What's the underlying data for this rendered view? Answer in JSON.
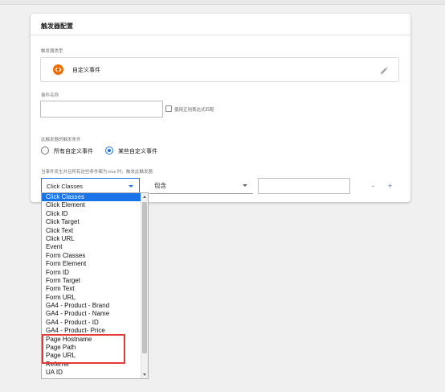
{
  "card": {
    "title": "触发器配置",
    "trigger_type_label": "触发器类型",
    "trigger_type_name": "自定义事件",
    "event_name_label": "事件名称",
    "event_name_value": "",
    "regex_checkbox_label": "使用正则表达式匹配",
    "fires_on_label": "此触发器的触发条件",
    "radio_all": "所有自定义事件",
    "radio_some": "某些自定义事件",
    "condition_label": "当事件发生并且所有这些条件都为 true 时，触发此触发器",
    "variable_select": "Click Classes",
    "operator_select": "包含",
    "condition_value": "",
    "remove_button": "-",
    "add_button": "+"
  },
  "dropdown": {
    "selected": "Click Classes",
    "items": [
      "Click Classes",
      "Click Element",
      "Click ID",
      "Click Target",
      "Click Text",
      "Click URL",
      "Event",
      "Form Classes",
      "Form Element",
      "Form ID",
      "Form Target",
      "Form Text",
      "Form URL",
      "GA4 - Product - Brand",
      "GA4 - Product - Name",
      "GA4 - Product - ID",
      "GA4 - Product- Price",
      "Page Hostname",
      "Page Path",
      "Page URL",
      "Referrer",
      "UA ID"
    ]
  },
  "colors": {
    "accent": "#1a73e8",
    "trigger_icon": "#ef6c00",
    "highlight_box": "#e53935"
  }
}
